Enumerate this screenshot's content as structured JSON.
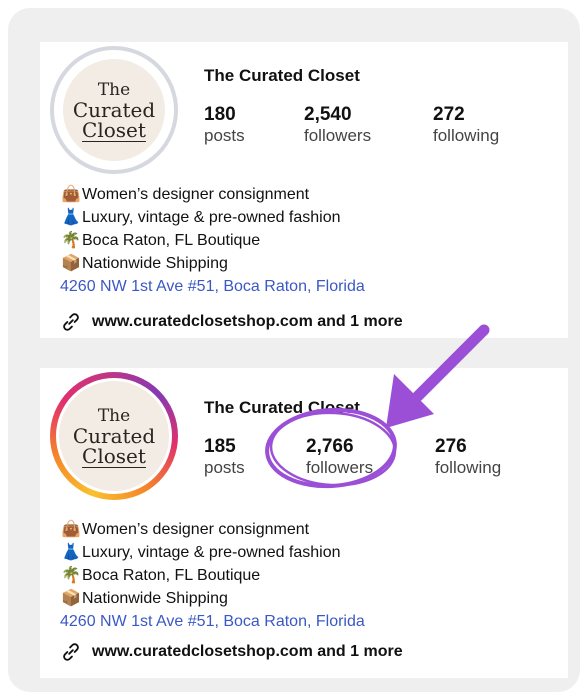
{
  "profiles": [
    {
      "logo": {
        "line1": "The",
        "line2": "Curated",
        "line3": "Closet"
      },
      "name": "The Curated Closet",
      "stats": [
        {
          "value": "180",
          "label": "posts"
        },
        {
          "value": "2,540",
          "label": "followers"
        },
        {
          "value": "272",
          "label": "following"
        }
      ],
      "bio": [
        {
          "icon": "handbag-icon",
          "text": "Women’s designer consignment"
        },
        {
          "icon": "dress-icon",
          "text": "Luxury, vintage & pre-owned fashion"
        },
        {
          "icon": "palm-tree-icon",
          "text": "Boca Raton, FL Boutique"
        },
        {
          "icon": "package-icon",
          "text": "Nationwide Shipping"
        }
      ],
      "address": "4260 NW 1st Ave #51, Boca Raton, Florida",
      "link": "www.curatedclosetshop.com and 1 more",
      "story_ring": false
    },
    {
      "logo": {
        "line1": "The",
        "line2": "Curated",
        "line3": "Closet"
      },
      "name": "The Curated Closet",
      "stats": [
        {
          "value": "185",
          "label": "posts"
        },
        {
          "value": "2,766",
          "label": "followers"
        },
        {
          "value": "276",
          "label": "following"
        }
      ],
      "bio": [
        {
          "icon": "handbag-icon",
          "text": "Women’s designer consignment"
        },
        {
          "icon": "dress-icon",
          "text": "Luxury, vintage & pre-owned fashion"
        },
        {
          "icon": "palm-tree-icon",
          "text": "Boca Raton, FL Boutique"
        },
        {
          "icon": "package-icon",
          "text": "Nationwide Shipping"
        }
      ],
      "address": "4260 NW 1st Ave #51, Boca Raton, Florida",
      "link": "www.curatedclosetshop.com and 1 more",
      "story_ring": true
    }
  ],
  "annotation": {
    "color": "#9b4fd6",
    "target": "followers-count-after"
  },
  "colors": {
    "address_link": "#3b58c4",
    "background": "#efefef"
  }
}
